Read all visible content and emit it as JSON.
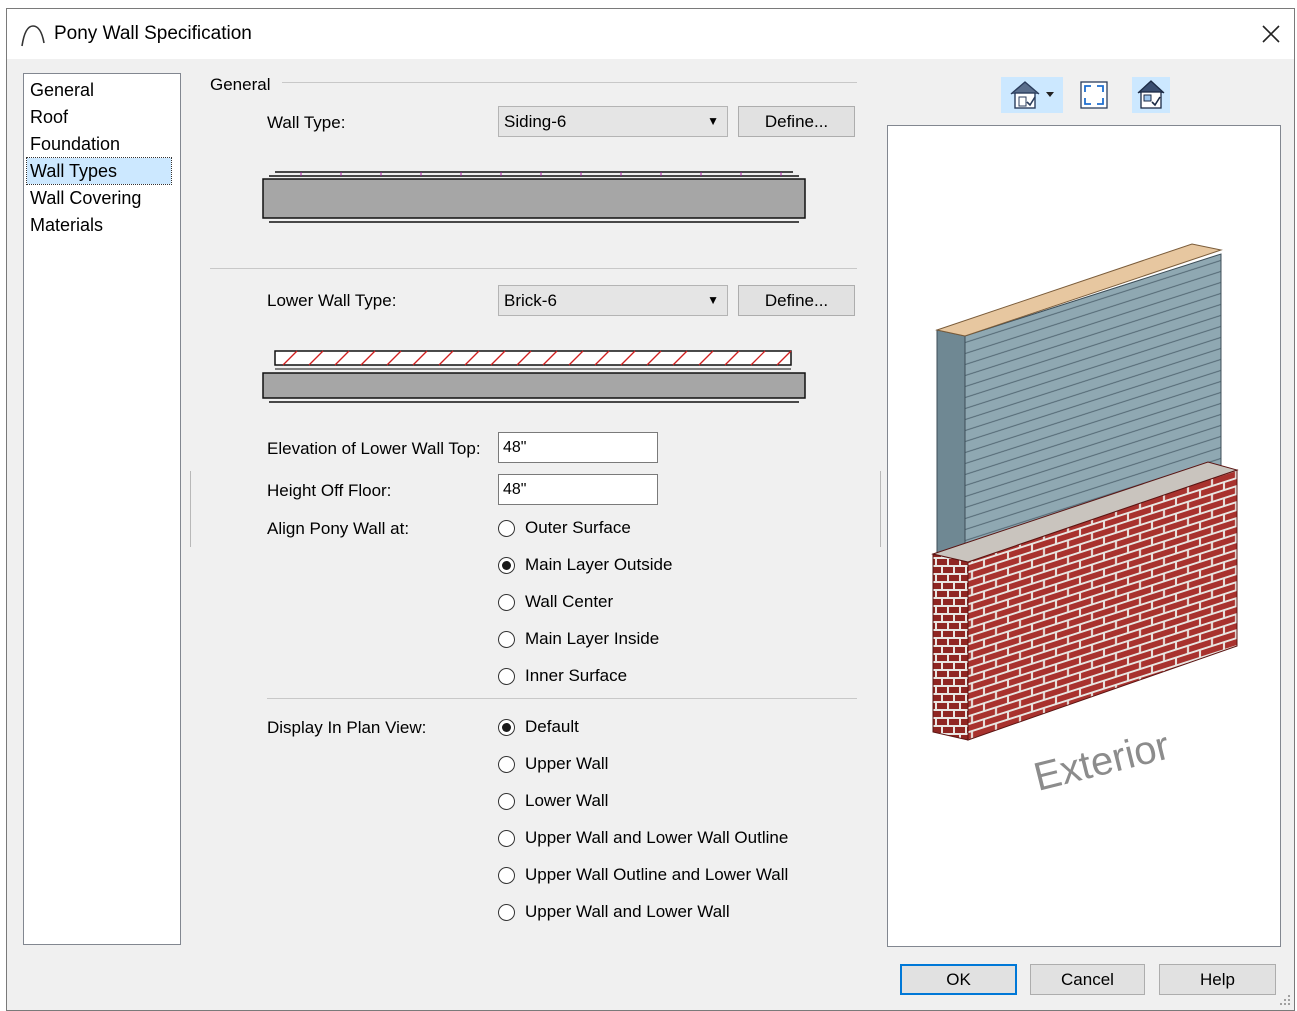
{
  "window": {
    "title": "Pony Wall Specification"
  },
  "nav": {
    "items": [
      "General",
      "Roof",
      "Foundation",
      "Wall Types",
      "Wall Covering",
      "Materials"
    ],
    "selected": "Wall Types"
  },
  "panel": {
    "group_label": "General",
    "wall_type_label": "Wall Type:",
    "wall_type_value": "Siding-6",
    "define_label": "Define...",
    "lower_wall_type_label": "Lower Wall Type:",
    "lower_wall_type_value": "Brick-6",
    "elevation_label": "Elevation of Lower Wall Top:",
    "elevation_value": "48\"",
    "height_label": "Height Off Floor:",
    "height_value": "48\"",
    "align_label": "Align Pony Wall at:",
    "align_options": [
      "Outer Surface",
      "Main Layer Outside",
      "Wall Center",
      "Main Layer Inside",
      "Inner Surface"
    ],
    "align_selected": "Main Layer Outside",
    "display_label": "Display In Plan View:",
    "display_options": [
      "Default",
      "Upper Wall",
      "Lower Wall",
      "Upper Wall and Lower Wall Outline",
      "Upper Wall Outline and Lower Wall",
      "Upper Wall and Lower Wall"
    ],
    "display_selected": "Default"
  },
  "preview": {
    "exterior_label": "Exterior"
  },
  "buttons": {
    "ok": "OK",
    "cancel": "Cancel",
    "help": "Help"
  },
  "icons": [
    "arc-icon",
    "close-icon",
    "camera-view-icon",
    "dropdown-arrow-icon",
    "fill-window-icon",
    "color-view-icon"
  ],
  "colors": {
    "siding": "#8fa8b2",
    "brick": "#a8322e",
    "mortar": "#e9e6e2",
    "wall_top": "#e7c7a0",
    "selection": "#cce8ff",
    "accent": "#0078d7"
  }
}
